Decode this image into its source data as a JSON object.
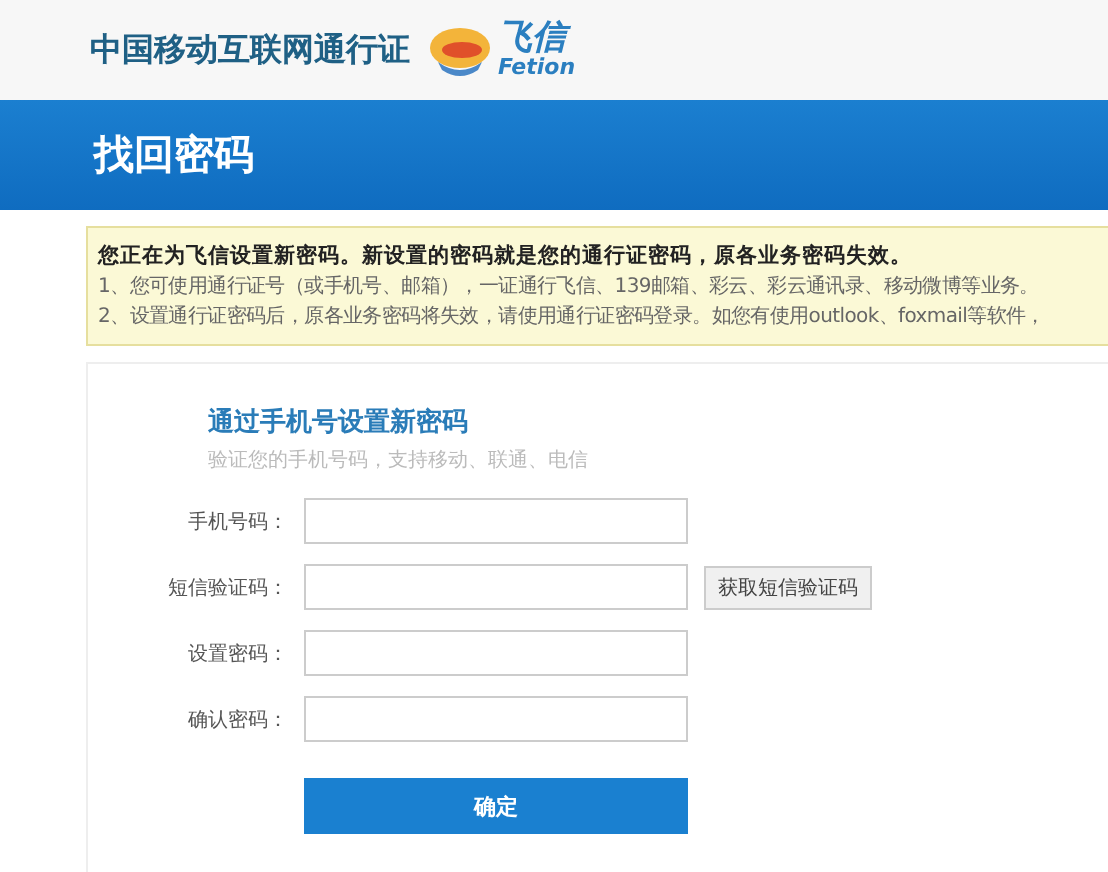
{
  "header": {
    "site_title": "中国移动互联网通行证",
    "logo_text": "飞信",
    "logo_subtext": "Fetion"
  },
  "banner": {
    "title": "找回密码"
  },
  "notice": {
    "heading": "您正在为飞信设置新密码。新设置的密码就是您的通行证密码，原各业务密码失效。",
    "lines": [
      "1、您可使用通行证号（或手机号、邮箱），一证通行飞信、139邮箱、彩云、彩云通讯录、移动微博等业务。",
      "2、设置通行证密码后，原各业务密码将失效，请使用通行证密码登录。如您有使用outlook、foxmail等软件，"
    ]
  },
  "form": {
    "title": "通过手机号设置新密码",
    "subtitle": "验证您的手机号码，支持移动、联通、电信",
    "fields": [
      {
        "label": "手机号码：",
        "kind": "text"
      },
      {
        "label": "短信验证码：",
        "kind": "sms",
        "button": "获取短信验证码"
      },
      {
        "label": "设置密码：",
        "kind": "password"
      },
      {
        "label": "确认密码：",
        "kind": "password"
      }
    ],
    "submit": "确定"
  }
}
